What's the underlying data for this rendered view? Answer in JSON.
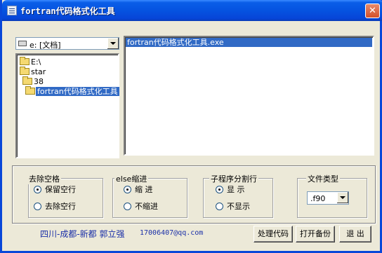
{
  "window": {
    "title": "fortran代码格式化工具",
    "close_glyph": "✕"
  },
  "drive_combo": {
    "value": "e: [文档]",
    "icon": "drive-icon"
  },
  "directories": [
    {
      "label": "E:\\",
      "icon": "folder-open-icon"
    },
    {
      "label": "star",
      "icon": "folder-open-icon"
    },
    {
      "label": "38",
      "icon": "folder-open-icon"
    },
    {
      "label": "fortran代码格式化工具",
      "icon": "folder-open-icon",
      "selected": true
    }
  ],
  "files": [
    {
      "label": "fortran代码格式化工具.exe",
      "selected": true
    }
  ],
  "groups": {
    "spaces": {
      "title": "去除空格",
      "options": [
        "保留空行",
        "去除空行"
      ],
      "selected": 0
    },
    "else_indent": {
      "title": "else缩进",
      "options": [
        "缩 进",
        "不缩进"
      ],
      "selected": 0
    },
    "subroutine_split": {
      "title": "子程序分割行",
      "options": [
        "显 示",
        "不显示"
      ],
      "selected": 0
    },
    "file_type": {
      "title": "文件类型",
      "value": ".f90"
    }
  },
  "footer": {
    "author": "四川-成都-新都  郭立强",
    "email": "17006407@qq.com"
  },
  "buttons": {
    "process": "处理代码",
    "backup": "打开备份",
    "exit": "退 出"
  },
  "colors": {
    "titlebar": "#0553e0",
    "selection": "#316ac5",
    "footer_text": "#1a2fa8",
    "window_bg": "#ece9d8"
  }
}
